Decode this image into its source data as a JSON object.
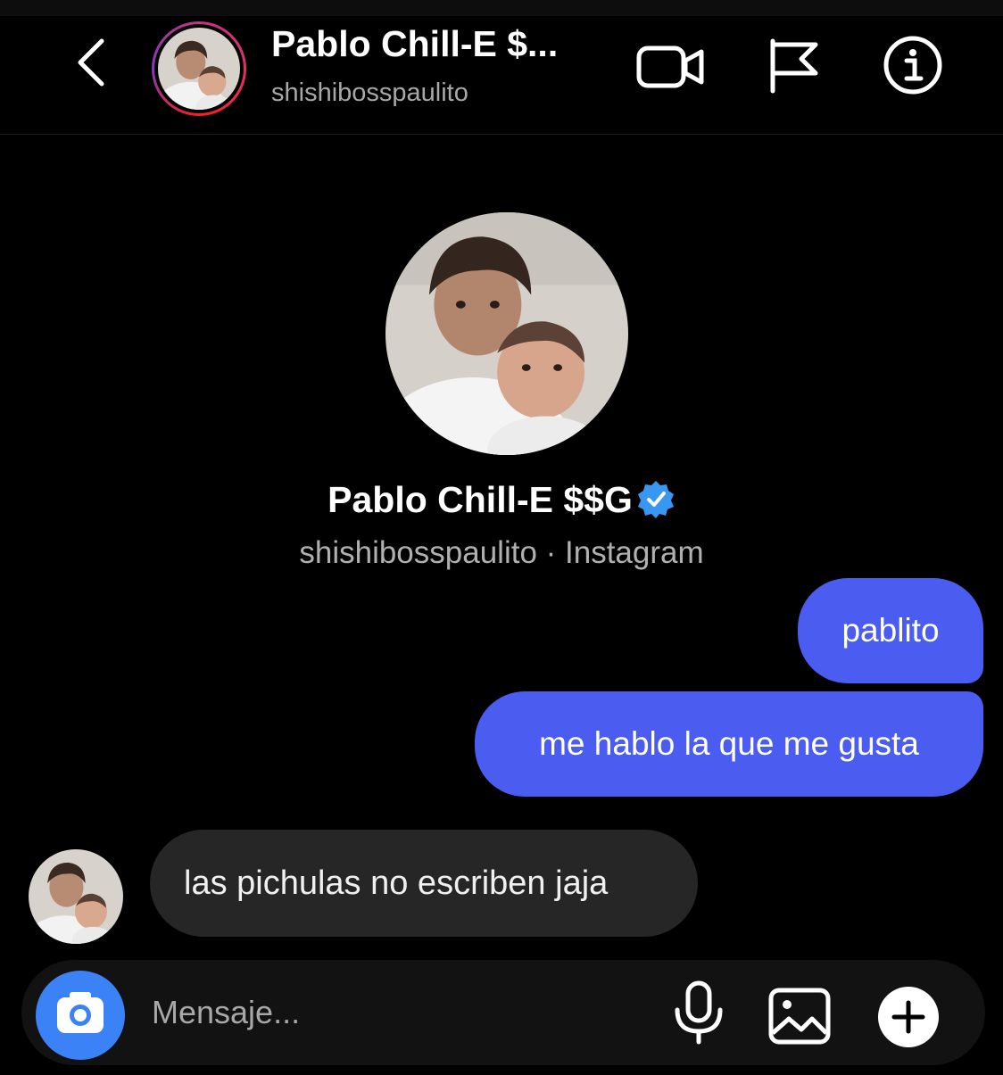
{
  "header": {
    "name": "Pablo Chill-E $...",
    "username": "shishibosspaulito"
  },
  "profile": {
    "name": "Pablo Chill-E $$G",
    "subtitle": "shishibosspaulito · Instagram"
  },
  "messages": [
    {
      "direction": "outgoing",
      "text": "pablito"
    },
    {
      "direction": "outgoing",
      "text": "me hablo la que me gusta"
    },
    {
      "direction": "incoming",
      "text": "las pichulas no escriben jaja"
    }
  ],
  "composer": {
    "placeholder": "Mensaje..."
  },
  "icons": {
    "back": "chevron-left-icon",
    "video": "video-camera-icon",
    "flag": "flag-icon",
    "info": "info-icon",
    "verified": "verified-badge-icon",
    "camera": "camera-icon",
    "mic": "microphone-icon",
    "gallery": "gallery-icon",
    "plus": "plus-icon"
  },
  "colors": {
    "background": "#000000",
    "outgoing_bubble": "#4b5cf0",
    "incoming_bubble": "#262626",
    "camera_button": "#3b82f6",
    "verified": "#3897f0"
  }
}
